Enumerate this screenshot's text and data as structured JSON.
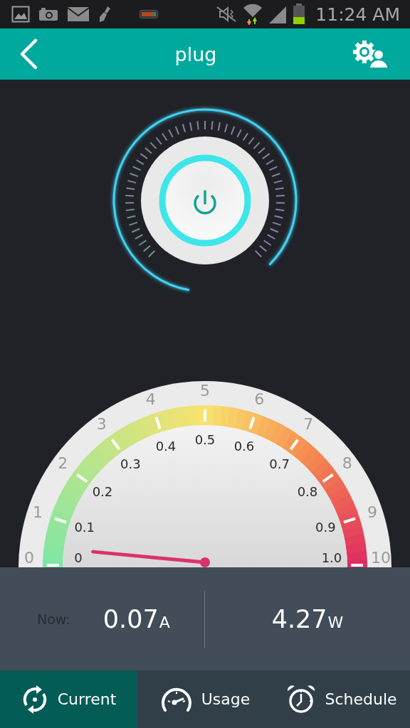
{
  "status_bar": {
    "time": "11:24 AM"
  },
  "app_bar": {
    "title": "plug"
  },
  "power_button": {
    "on": true
  },
  "gauge": {
    "outer_scale": [
      "0",
      "1",
      "2",
      "3",
      "4",
      "5",
      "6",
      "7",
      "8",
      "9",
      "10"
    ],
    "inner_scale": [
      "0",
      "0.1",
      "0.2",
      "0.3",
      "0.4",
      "0.5",
      "0.6",
      "0.7",
      "0.8",
      "0.9",
      "1.0"
    ]
  },
  "readout": {
    "label": "Now:",
    "current": {
      "value": "0.07",
      "unit": "A"
    },
    "power": {
      "value": "4.27",
      "unit": "W"
    }
  },
  "tabs": [
    {
      "label": "Current",
      "kind": "cycle",
      "selected": true
    },
    {
      "label": "Usage",
      "kind": "speed",
      "selected": false
    },
    {
      "label": "Schedule",
      "kind": "alarm",
      "selected": false
    }
  ]
}
